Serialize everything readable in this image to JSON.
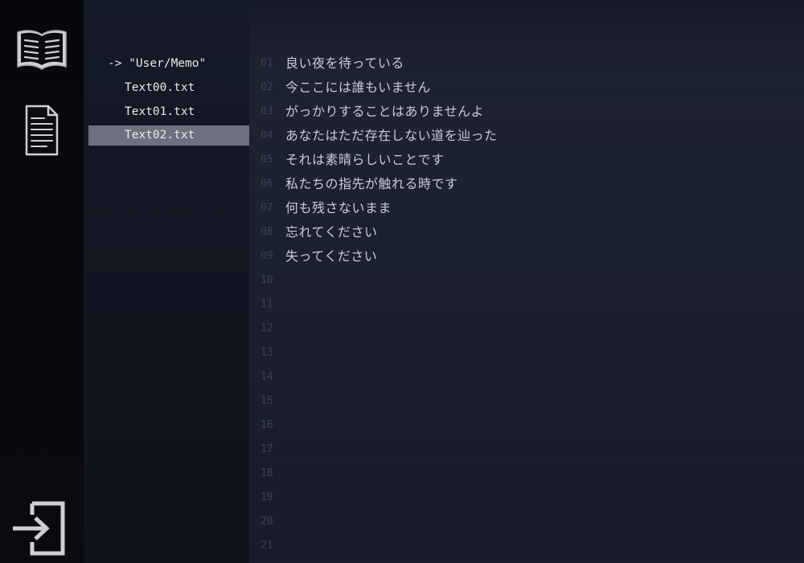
{
  "rail": {
    "icons": [
      "open-book-icon",
      "document-icon",
      "exit-icon"
    ]
  },
  "tree": {
    "folder": "-> \"User/Memo\"",
    "files": [
      "Text00.txt",
      "Text01.txt",
      "Text02.txt"
    ],
    "selected": "Text02.txt"
  },
  "editor": {
    "lines": [
      {
        "num": "01",
        "text": "良い夜を待っている"
      },
      {
        "num": "02",
        "text": "今ここには誰もいません"
      },
      {
        "num": "03",
        "text": "がっかりすることはありませんよ"
      },
      {
        "num": "04",
        "text": "あなたはただ存在しない道を辿った"
      },
      {
        "num": "05",
        "text": "それは素晴らしいことです"
      },
      {
        "num": "06",
        "text": "私たちの指先が触れる時です"
      },
      {
        "num": "07",
        "text": "何も残さないまま"
      },
      {
        "num": "08",
        "text": "忘れてください"
      },
      {
        "num": "09",
        "text": "失ってください"
      },
      {
        "num": "10",
        "text": ""
      },
      {
        "num": "11",
        "text": ""
      },
      {
        "num": "12",
        "text": ""
      },
      {
        "num": "13",
        "text": ""
      },
      {
        "num": "14",
        "text": ""
      },
      {
        "num": "15",
        "text": ""
      },
      {
        "num": "16",
        "text": ""
      },
      {
        "num": "17",
        "text": ""
      },
      {
        "num": "18",
        "text": ""
      },
      {
        "num": "19",
        "text": ""
      },
      {
        "num": "20",
        "text": ""
      },
      {
        "num": "21",
        "text": ""
      }
    ]
  },
  "colors": {
    "selection": "#6d717e",
    "line_number": "#3b4254",
    "text": "#c9ccd6",
    "icon": "#c8c9cd"
  }
}
